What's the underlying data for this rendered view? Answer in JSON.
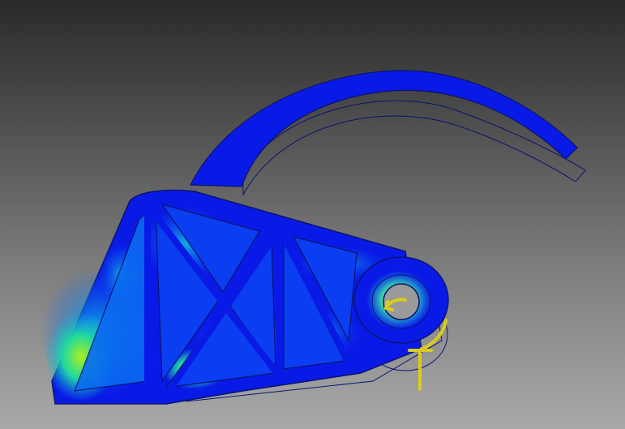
{
  "viewport": {
    "background_top": "#2a2a2a",
    "background_bottom": "#a9a9a9"
  },
  "model": {
    "stress_colors": {
      "low": "#0a1ae6",
      "low_mid": "#0a5cf0",
      "mid": "#10b0e0",
      "mid_high": "#20d8a0",
      "high": "#a8f020"
    },
    "outline_color": "#0a1470",
    "constraint_color": "#d8cc20"
  }
}
